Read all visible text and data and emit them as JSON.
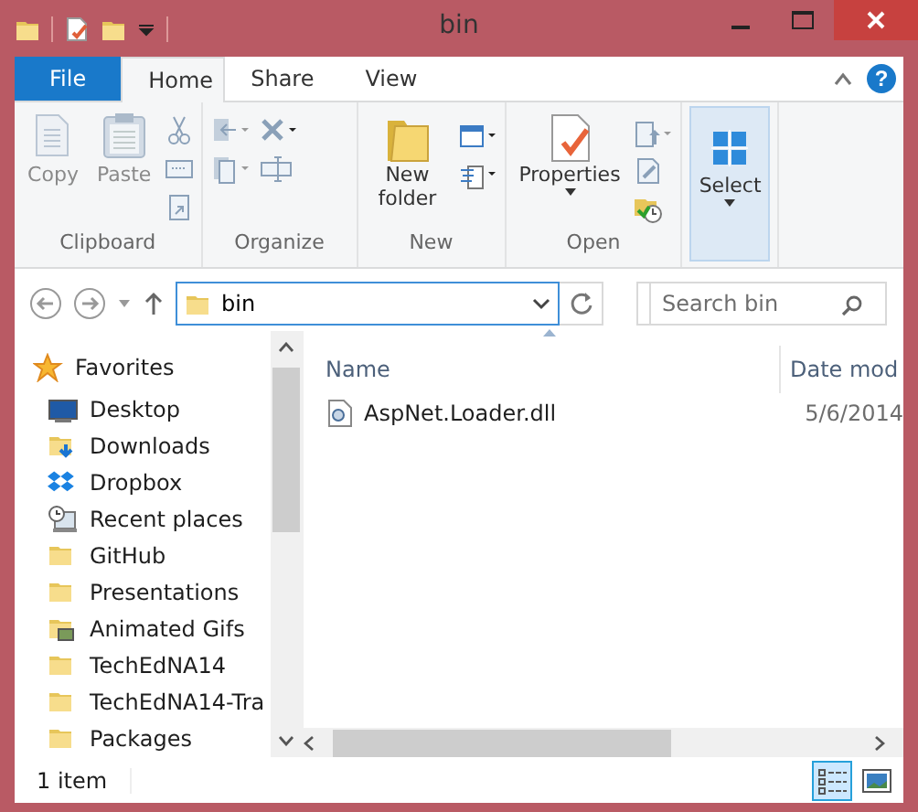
{
  "window": {
    "title": "bin"
  },
  "ribbon": {
    "tabs": [
      {
        "label": "File",
        "kind": "file",
        "selected": false
      },
      {
        "label": "Home",
        "kind": "tab",
        "selected": true
      },
      {
        "label": "Share",
        "kind": "tab",
        "selected": false
      },
      {
        "label": "View",
        "kind": "tab",
        "selected": false
      }
    ],
    "help": "?",
    "groups": [
      {
        "kind": "clipboard",
        "label": "Clipboard",
        "buttons": [
          {
            "label": "Copy",
            "disabled": true
          },
          {
            "label": "Paste",
            "disabled": true
          }
        ]
      },
      {
        "kind": "organize",
        "label": "Organize"
      },
      {
        "kind": "new",
        "label": "New",
        "buttons": [
          {
            "label": "New folder",
            "disabled": false
          }
        ]
      },
      {
        "kind": "open",
        "label": "Open",
        "buttons": [
          {
            "label": "Properties",
            "disabled": false,
            "dropdown": true
          }
        ]
      },
      {
        "kind": "select",
        "buttons": [
          {
            "label": "Select",
            "disabled": false,
            "dropdown": true,
            "selected": true
          }
        ]
      }
    ]
  },
  "address": {
    "path": "bin",
    "search_placeholder": "Search bin"
  },
  "nav": {
    "items": [
      {
        "label": "Favorites",
        "kind": "favorites",
        "children": [
          {
            "label": "Desktop",
            "kind": "desktop"
          },
          {
            "label": "Downloads",
            "kind": "downloads"
          },
          {
            "label": "Dropbox",
            "kind": "dropbox"
          },
          {
            "label": "Recent places",
            "kind": "recent"
          },
          {
            "label": "GitHub",
            "kind": "folder"
          },
          {
            "label": "Presentations",
            "kind": "folder"
          },
          {
            "label": "Animated Gifs",
            "kind": "pictures"
          },
          {
            "label": "TechEdNA14",
            "kind": "folder"
          },
          {
            "label": "TechEdNA14-Tra",
            "kind": "folder"
          },
          {
            "label": "Packages",
            "kind": "folder"
          }
        ]
      }
    ]
  },
  "files": {
    "columns": [
      {
        "label": "Name",
        "sorted": true
      },
      {
        "label": "Date mod",
        "sorted": false
      }
    ],
    "rows": [
      {
        "name": "AspNet.Loader.dll",
        "date": "5/6/2014",
        "selected": false
      }
    ]
  },
  "status_bar": {
    "text": "1 item",
    "views": [
      {
        "kind": "details",
        "selected": true
      },
      {
        "kind": "large-icons",
        "selected": false
      }
    ]
  }
}
